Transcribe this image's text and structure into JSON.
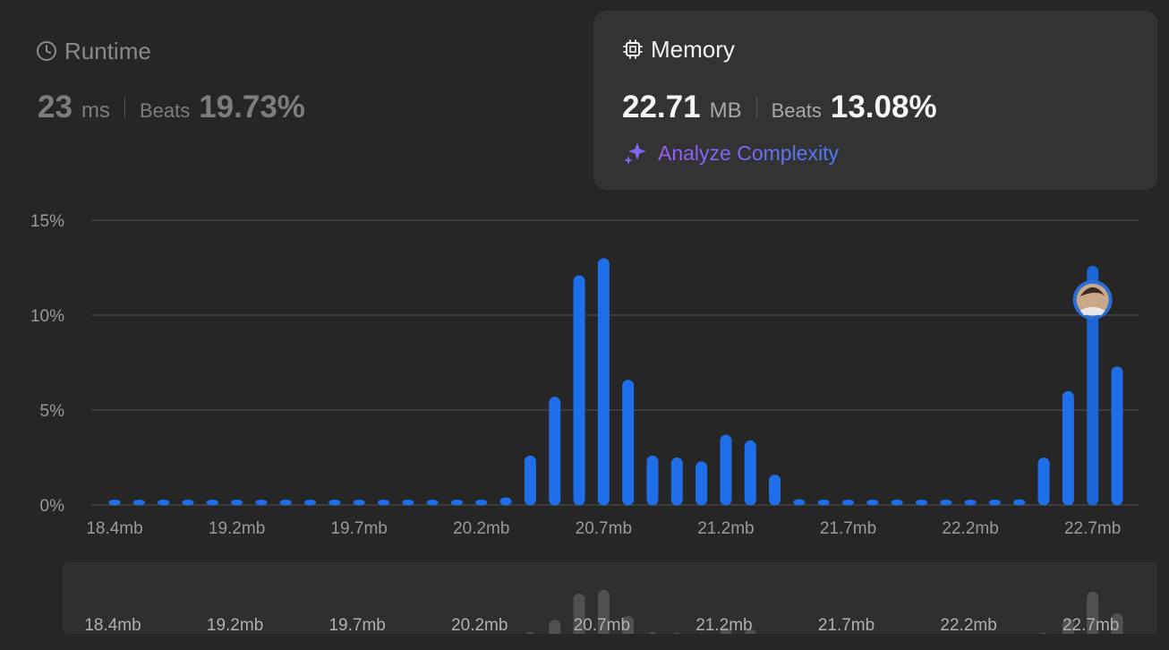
{
  "runtime": {
    "title": "Runtime",
    "value": "23",
    "unit": "ms",
    "beats_label": "Beats",
    "beats_value": "19.73%"
  },
  "memory": {
    "title": "Memory",
    "value": "22.71",
    "unit": "MB",
    "beats_label": "Beats",
    "beats_value": "13.08%",
    "analyze_label": "Analyze Complexity"
  },
  "icons": {
    "runtime": "clock-icon",
    "memory": "chip-icon",
    "analyze": "sparkle-icon"
  },
  "colors": {
    "bar": "#1f6feb",
    "bar_highlight": "#1a66d6",
    "grid": "#444444",
    "axis_text": "#9a9a9a",
    "minimap_bar": "#505050"
  },
  "chart_data": {
    "type": "bar",
    "title": "",
    "xlabel": "",
    "ylabel": "",
    "ylim": [
      0,
      15
    ],
    "yticks": [
      "0%",
      "5%",
      "10%",
      "15%"
    ],
    "x_tick_labels": [
      "18.4mb",
      "19.2mb",
      "19.7mb",
      "20.2mb",
      "20.7mb",
      "21.2mb",
      "21.7mb",
      "22.2mb",
      "22.7mb"
    ],
    "x_tick_indices": [
      0,
      5,
      10,
      15,
      20,
      25,
      30,
      35,
      40
    ],
    "values": [
      0.2,
      0.2,
      0.2,
      0.2,
      0.2,
      0.2,
      0.2,
      0.2,
      0.2,
      0.2,
      0.2,
      0.2,
      0.2,
      0.2,
      0.2,
      0.2,
      0.4,
      2.6,
      5.7,
      12.1,
      13.0,
      6.6,
      2.6,
      2.5,
      2.3,
      3.7,
      3.4,
      1.6,
      0.3,
      0.2,
      0.2,
      0.2,
      0.2,
      0.2,
      0.2,
      0.2,
      0.2,
      0.3,
      2.5,
      6.0,
      12.6,
      7.3
    ],
    "highlight_index": 40,
    "grid": true
  }
}
